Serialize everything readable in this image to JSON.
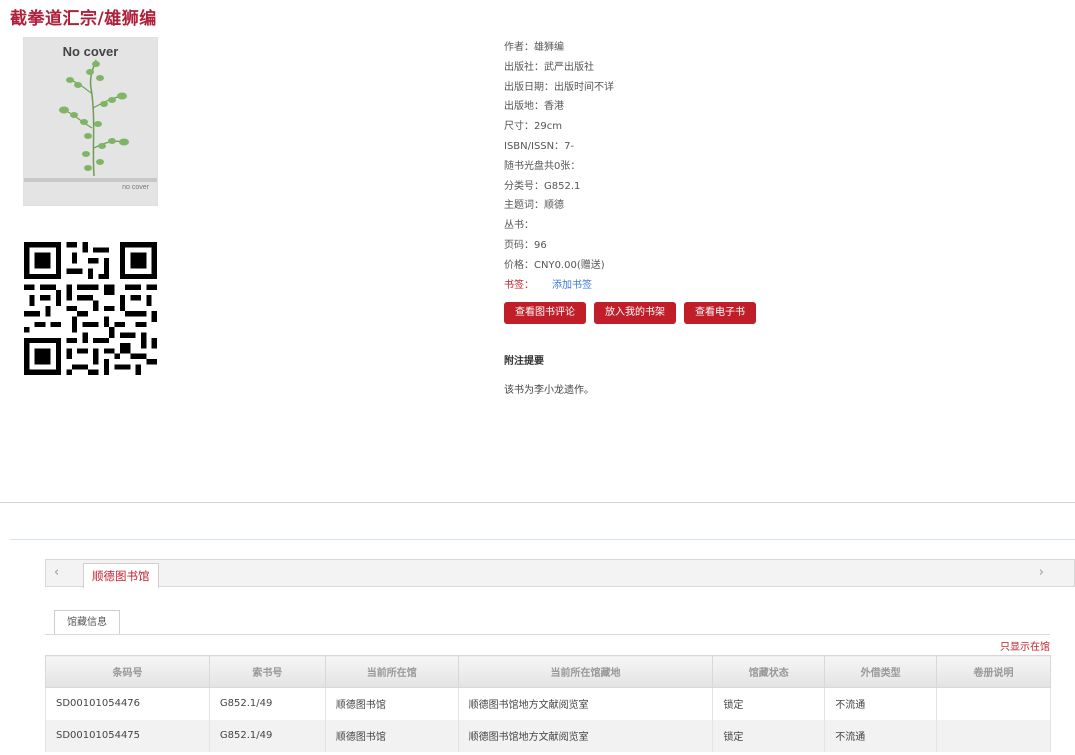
{
  "page": {
    "title": "截拳道汇宗/雄狮编"
  },
  "cover": {
    "top_text": "No cover",
    "bottom_text": "no cover"
  },
  "details": {
    "author": "作者：雄狮编",
    "publisher": "出版社：武严出版社",
    "pub_date": "出版日期：出版时间不详",
    "pub_place": "出版地：香港",
    "size": "尺寸：29cm",
    "isbn": "ISBN/ISSN：7-",
    "disc": "随书光盘共0张：",
    "class_no": "分类号：G852.1",
    "subject": "主题词：顺德",
    "series": "丛书：",
    "pages": "页码：96",
    "price": "价格：CNY0.00(赠送)",
    "tag_label": "书签：",
    "tag_link": "添加书签"
  },
  "actions": {
    "review": "查看图书评论",
    "shelf": "放入我的书架",
    "ebook": "查看电子书"
  },
  "summary": {
    "title": "附注提要",
    "text": "该书为李小龙遗作。"
  },
  "library": {
    "tab_name": "顺德图书馆",
    "left_arrow": "‹",
    "right_arrow": "›",
    "inner_tab": "馆藏信息",
    "only_show": "只显示在馆",
    "headers": [
      "条码号",
      "索书号",
      "当前所在馆",
      "当前所在馆藏地",
      "馆藏状态",
      "外借类型",
      "卷册说明"
    ],
    "rows": [
      [
        "SD00101054476",
        "G852.1/49",
        "顺德图书馆",
        "顺德图书馆地方文献阅览室",
        "锁定",
        "不流通",
        ""
      ],
      [
        "SD00101054475",
        "G852.1/49",
        "顺德图书馆",
        "顺德图书馆地方文献阅览室",
        "锁定",
        "不流通",
        ""
      ]
    ]
  }
}
